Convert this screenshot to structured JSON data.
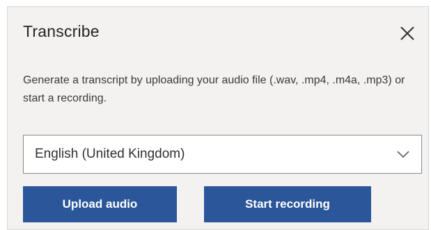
{
  "dialog": {
    "title": "Transcribe",
    "close_icon": "close-icon",
    "description": "Generate a transcript by uploading your audio file (.wav, .mp4, .m4a, .mp3) or start a recording.",
    "language_select": {
      "selected": "English (United Kingdom)",
      "dropdown_icon": "chevron-down-icon"
    },
    "buttons": {
      "upload_label": "Upload audio",
      "record_label": "Start recording"
    }
  },
  "colors": {
    "panel_background": "#f3f2f1",
    "button_background": "#2b579a",
    "button_text": "#ffffff"
  }
}
